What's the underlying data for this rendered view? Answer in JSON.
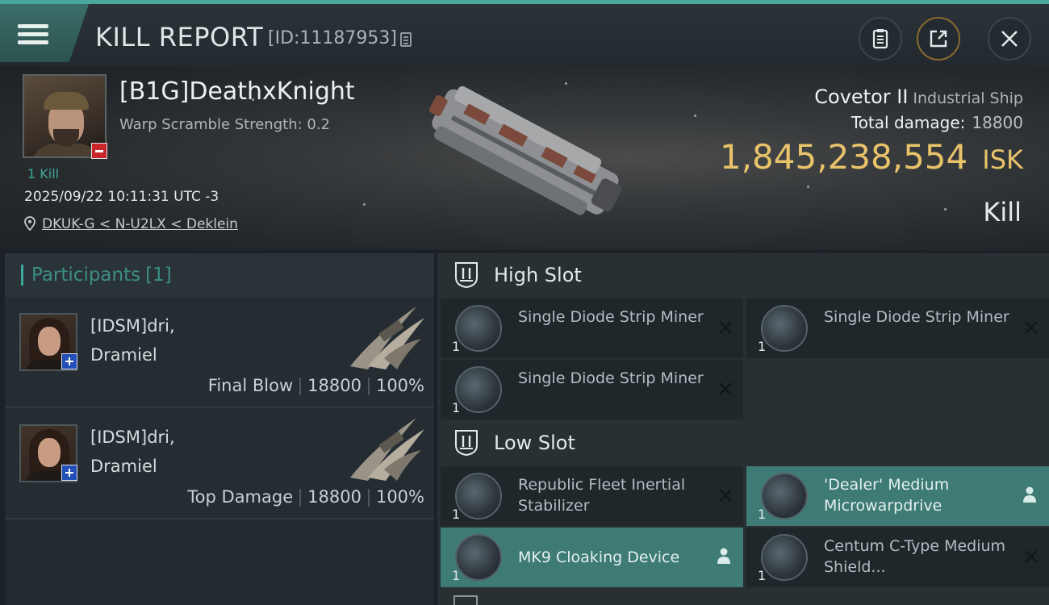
{
  "header": {
    "title": "KILL REPORT",
    "report_id": "[ID:11187953]",
    "icons": [
      "menu-icon",
      "copy-icon",
      "clipboard-icon",
      "share-icon",
      "close-icon"
    ]
  },
  "victim": {
    "name": "[B1G]DeathxKnight",
    "warp_scramble": "Warp Scramble Strength: 0.2",
    "kill_count": "1 Kill",
    "timestamp": "2025/09/22 10:11:31 UTC -3",
    "location": "DKUK-G < N-U2LX < Deklein",
    "ship_name": "Covetor II",
    "ship_class": "Industrial Ship",
    "total_damage_label": "Total damage:",
    "total_damage": "18800",
    "isk_value": "1,845,238,554",
    "isk_unit": "ISK",
    "outcome": "Kill"
  },
  "participants": {
    "label": "Participants",
    "count": "[1]",
    "rows": [
      {
        "name_line1": "[IDSM]dri,",
        "name_line2": "Dramiel",
        "role": "Final Blow",
        "damage": "18800",
        "percent": "100%"
      },
      {
        "name_line1": "[IDSM]dri,",
        "name_line2": "Dramiel",
        "role": "Top Damage",
        "damage": "18800",
        "percent": "100%"
      }
    ]
  },
  "fitting": {
    "high_slot": {
      "title": "High Slot",
      "modules": [
        {
          "name": "Single Diode Strip Miner",
          "qty": "1",
          "status": "destroyed"
        },
        {
          "name": "Single Diode Strip Miner",
          "qty": "1",
          "status": "destroyed"
        },
        {
          "name": "Single Diode Strip Miner",
          "qty": "1",
          "status": "destroyed"
        }
      ]
    },
    "low_slot": {
      "title": "Low Slot",
      "modules": [
        {
          "name": "Republic Fleet Inertial Stabilizer",
          "qty": "1",
          "status": "destroyed"
        },
        {
          "name": "'Dealer' Medium Microwarpdrive",
          "qty": "1",
          "status": "dropped"
        },
        {
          "name": "MK9 Cloaking Device",
          "qty": "1",
          "status": "dropped"
        },
        {
          "name": "Centum C-Type Medium Shield...",
          "qty": "1",
          "status": "destroyed"
        }
      ]
    }
  },
  "colors": {
    "accent": "#3ea89a",
    "isk": "#e8c36a",
    "dropped_highlight": "#3d7b74"
  }
}
